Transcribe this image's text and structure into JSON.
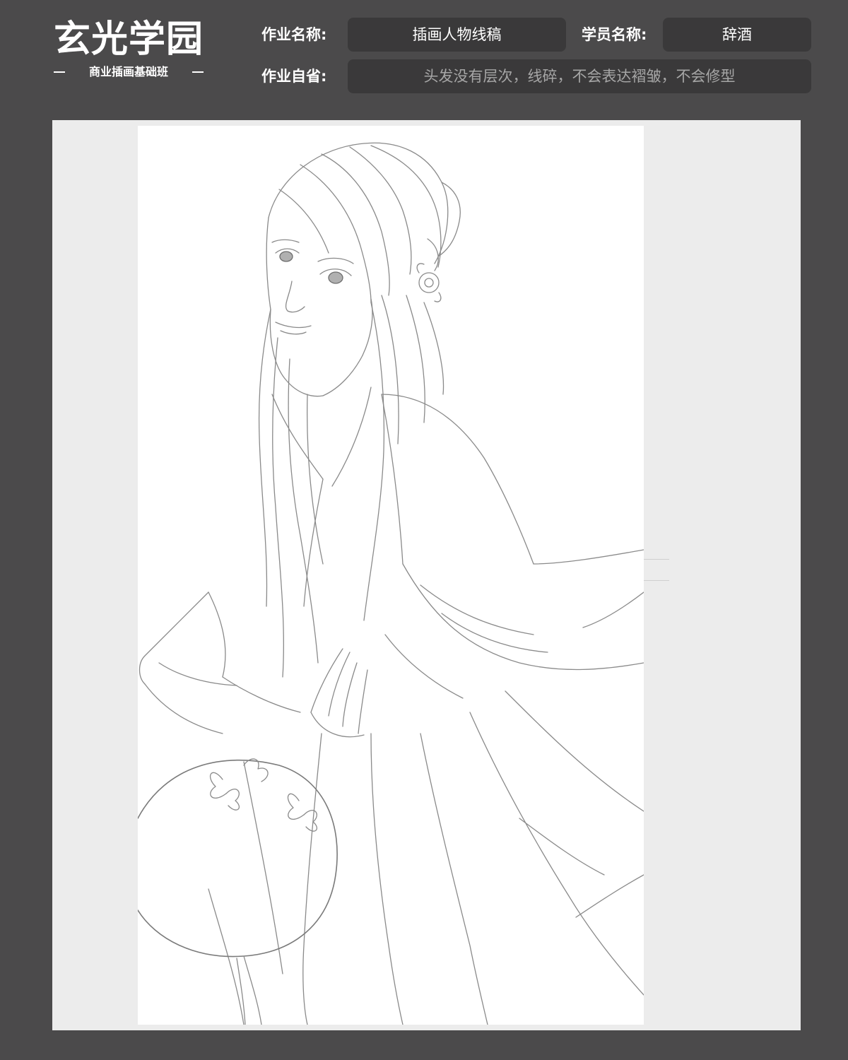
{
  "brand": {
    "title": "玄光学园",
    "subtitle": "商业插画基础班"
  },
  "header": {
    "assignment_name_label": "作业名称:",
    "assignment_name_value": "插画人物线稿",
    "student_name_label": "学员名称:",
    "student_name_value": "辞酒",
    "self_review_label": "作业自省:",
    "self_review_value": "头发没有层次，线碎，不会表达褶皱，不会修型"
  },
  "artwork": {
    "subject": "line-art-woman-with-round-fan-icon"
  }
}
